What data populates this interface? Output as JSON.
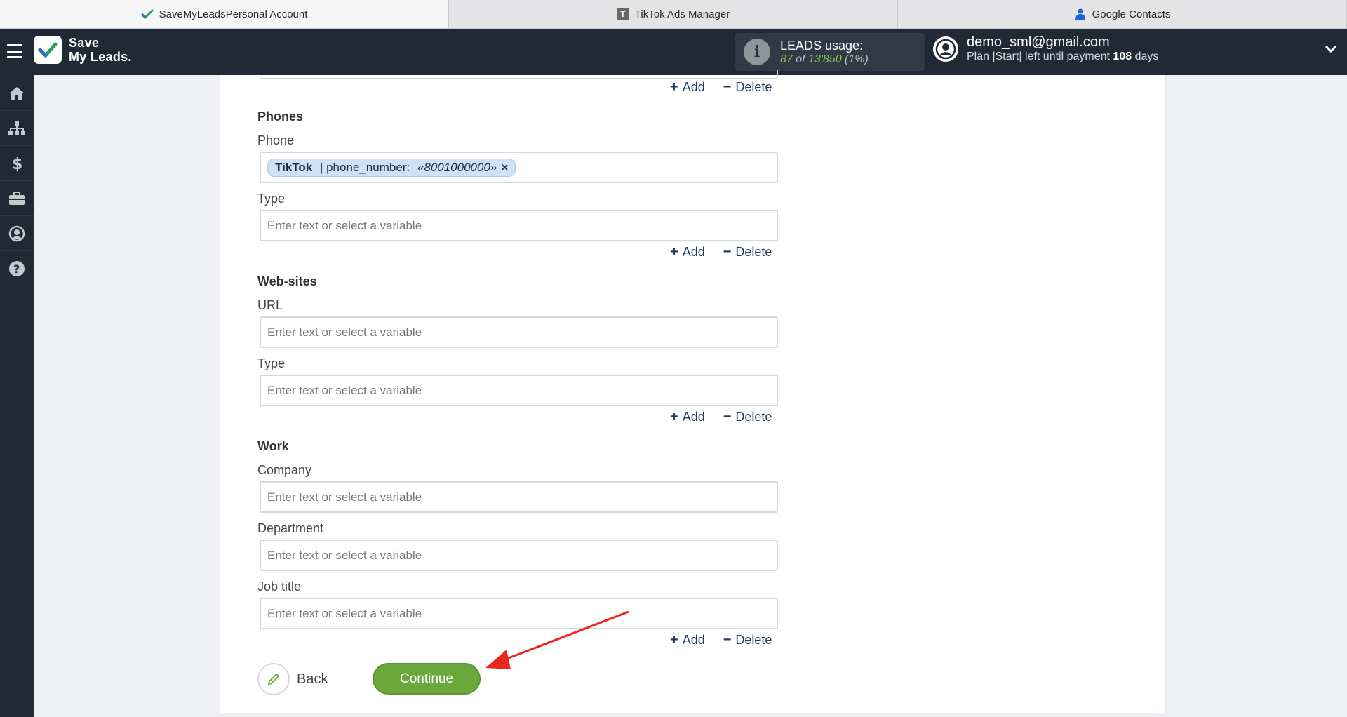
{
  "browser_tabs": [
    {
      "label": "SaveMyLeadsPersonal Account",
      "icon": "check-icon",
      "active": true
    },
    {
      "label": "TikTok Ads Manager",
      "icon": "t-letter-icon",
      "active": false
    },
    {
      "label": "Google Contacts",
      "icon": "person-icon",
      "active": false
    }
  ],
  "header": {
    "logo_line1": "Save",
    "logo_line2": "My Leads.",
    "leads_title": "LEADS usage:",
    "leads_used": "87",
    "leads_of": "of",
    "leads_total": "13'850",
    "leads_pct": "(1%)",
    "email": "demo_sml@gmail.com",
    "plan_text": "Plan |Start| left until payment",
    "plan_days": "108",
    "plan_days_suffix": "days"
  },
  "sidebar": {
    "items": [
      "home-icon",
      "sitemap-icon",
      "dollar-icon",
      "briefcase-icon",
      "user-circle-icon",
      "help-icon"
    ]
  },
  "form": {
    "add_label": "Add",
    "delete_label": "Delete",
    "placeholder": "Enter text or select a variable",
    "phones": {
      "title": "Phones",
      "phone_label": "Phone",
      "chip_source": "TikTok",
      "chip_sep": " | phone_number: ",
      "chip_value": "«8001000000»",
      "chip_remove": "×",
      "type_label": "Type"
    },
    "websites": {
      "title": "Web-sites",
      "url_label": "URL",
      "type_label": "Type"
    },
    "work": {
      "title": "Work",
      "company_label": "Company",
      "department_label": "Department",
      "job_title_label": "Job title"
    },
    "back_label": "Back",
    "continue_label": "Continue"
  },
  "colors": {
    "header_bg": "#1f2a36",
    "continue_green": "#6aa83c",
    "leads_green": "#86c34a",
    "link_blue": "#1f3d63",
    "annotation_arrow": "#e8281e"
  }
}
